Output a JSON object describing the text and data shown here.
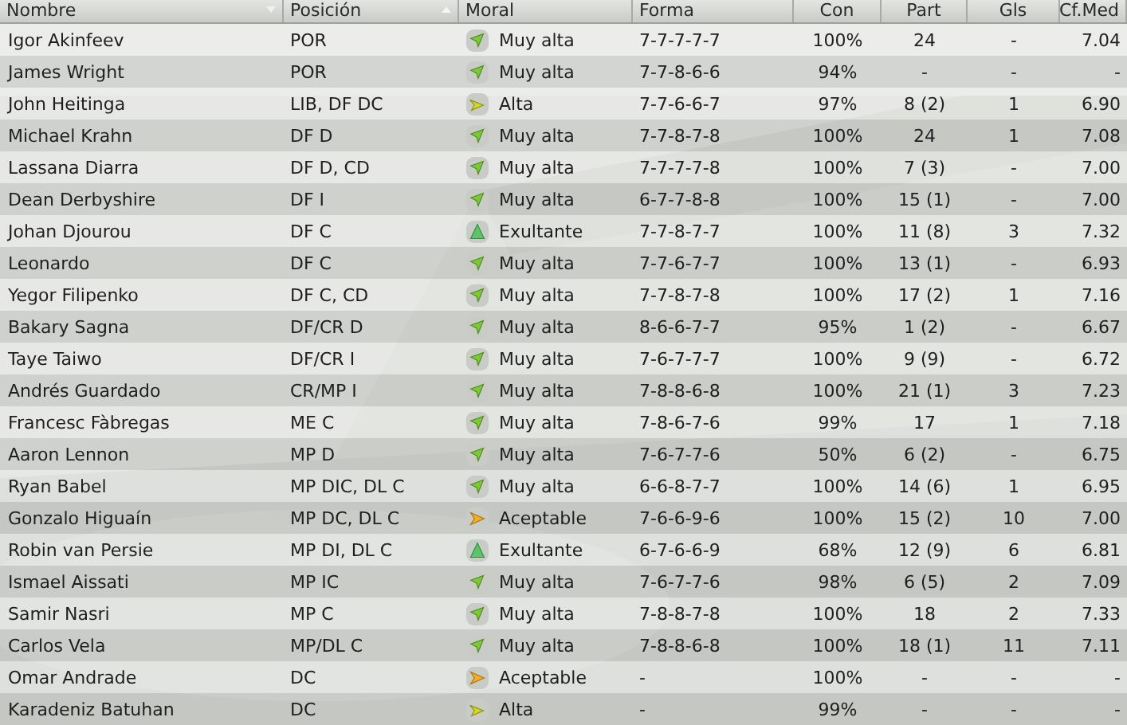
{
  "columns": [
    {
      "label": "Nombre",
      "sort_ascending": false,
      "sort_descending": true
    },
    {
      "label": "Posición",
      "sort_ascending": true,
      "sort_descending": false
    },
    {
      "label": "Moral",
      "sort_ascending": false,
      "sort_descending": false
    },
    {
      "label": "Forma",
      "sort_ascending": false,
      "sort_descending": false
    },
    {
      "label": "Con",
      "sort_ascending": false,
      "sort_descending": false
    },
    {
      "label": "Part",
      "sort_ascending": false,
      "sort_descending": false
    },
    {
      "label": "Gls",
      "sort_ascending": false,
      "sort_descending": false
    },
    {
      "label": "Cf.Med",
      "sort_ascending": false,
      "sort_descending": false
    }
  ],
  "rows": [
    {
      "name": "Igor Akinfeev",
      "position": "POR",
      "kind": "very_high",
      "morale": "Muy alta",
      "form": "7-7-7-7-7",
      "con": "100%",
      "part": "24",
      "gls": "-",
      "avg": "7.04"
    },
    {
      "name": "James Wright",
      "position": "POR",
      "kind": "very_high",
      "morale": "Muy alta",
      "form": "7-7-8-6-6",
      "con": "94%",
      "part": "-",
      "gls": "-",
      "avg": "-"
    },
    {
      "name": "John Heitinga",
      "position": "LIB, DF DC",
      "kind": "high",
      "morale": "Alta",
      "form": "7-7-6-6-7",
      "con": "97%",
      "part": "8 (2)",
      "gls": "1",
      "avg": "6.90"
    },
    {
      "name": "Michael Krahn",
      "position": "DF D",
      "kind": "very_high",
      "morale": "Muy alta",
      "form": "7-7-8-7-8",
      "con": "100%",
      "part": "24",
      "gls": "1",
      "avg": "7.08"
    },
    {
      "name": "Lassana Diarra",
      "position": "DF D, CD",
      "kind": "very_high",
      "morale": "Muy alta",
      "form": "7-7-7-7-8",
      "con": "100%",
      "part": "7 (3)",
      "gls": "-",
      "avg": "7.00"
    },
    {
      "name": "Dean Derbyshire",
      "position": "DF I",
      "kind": "very_high",
      "morale": "Muy alta",
      "form": "6-7-7-8-8",
      "con": "100%",
      "part": "15 (1)",
      "gls": "-",
      "avg": "7.00"
    },
    {
      "name": "Johan Djourou",
      "position": "DF C",
      "kind": "superb",
      "morale": "Exultante",
      "form": "7-7-8-7-7",
      "con": "100%",
      "part": "11 (8)",
      "gls": "3",
      "avg": "7.32"
    },
    {
      "name": "Leonardo",
      "position": "DF C",
      "kind": "very_high",
      "morale": "Muy alta",
      "form": "7-7-6-7-7",
      "con": "100%",
      "part": "13 (1)",
      "gls": "-",
      "avg": "6.93"
    },
    {
      "name": "Yegor Filipenko",
      "position": "DF C, CD",
      "kind": "very_high",
      "morale": "Muy alta",
      "form": "7-7-8-7-8",
      "con": "100%",
      "part": "17 (2)",
      "gls": "1",
      "avg": "7.16"
    },
    {
      "name": "Bakary Sagna",
      "position": "DF/CR D",
      "kind": "very_high",
      "morale": "Muy alta",
      "form": "8-6-6-7-7",
      "con": "95%",
      "part": "1 (2)",
      "gls": "-",
      "avg": "6.67"
    },
    {
      "name": "Taye Taiwo",
      "position": "DF/CR I",
      "kind": "very_high",
      "morale": "Muy alta",
      "form": "7-6-7-7-7",
      "con": "100%",
      "part": "9 (9)",
      "gls": "-",
      "avg": "6.72"
    },
    {
      "name": "Andrés Guardado",
      "position": "CR/MP I",
      "kind": "very_high",
      "morale": "Muy alta",
      "form": "7-8-8-6-8",
      "con": "100%",
      "part": "21 (1)",
      "gls": "3",
      "avg": "7.23"
    },
    {
      "name": "Francesc Fàbregas",
      "position": "ME C",
      "kind": "very_high",
      "morale": "Muy alta",
      "form": "7-8-6-7-6",
      "con": "99%",
      "part": "17",
      "gls": "1",
      "avg": "7.18"
    },
    {
      "name": "Aaron Lennon",
      "position": "MP D",
      "kind": "very_high",
      "morale": "Muy alta",
      "form": "7-6-7-7-6",
      "con": "50%",
      "part": "6 (2)",
      "gls": "-",
      "avg": "6.75"
    },
    {
      "name": "Ryan Babel",
      "position": "MP DIC, DL C",
      "kind": "very_high",
      "morale": "Muy alta",
      "form": "6-6-8-7-7",
      "con": "100%",
      "part": "14 (6)",
      "gls": "1",
      "avg": "6.95"
    },
    {
      "name": "Gonzalo Higuaín",
      "position": "MP DC, DL C",
      "kind": "acceptable",
      "morale": "Aceptable",
      "form": "7-6-6-9-6",
      "con": "100%",
      "part": "15 (2)",
      "gls": "10",
      "avg": "7.00"
    },
    {
      "name": "Robin van Persie",
      "position": "MP DI, DL C",
      "kind": "superb",
      "morale": "Exultante",
      "form": "6-7-6-6-9",
      "con": "68%",
      "part": "12 (9)",
      "gls": "6",
      "avg": "6.81"
    },
    {
      "name": "Ismael Aissati",
      "position": "MP IC",
      "kind": "very_high",
      "morale": "Muy alta",
      "form": "7-6-7-7-6",
      "con": "98%",
      "part": "6 (5)",
      "gls": "2",
      "avg": "7.09"
    },
    {
      "name": "Samir Nasri",
      "position": "MP C",
      "kind": "very_high",
      "morale": "Muy alta",
      "form": "7-8-8-7-8",
      "con": "100%",
      "part": "18",
      "gls": "2",
      "avg": "7.33"
    },
    {
      "name": "Carlos Vela",
      "position": "MP/DL C",
      "kind": "very_high",
      "morale": "Muy alta",
      "form": "7-8-8-6-8",
      "con": "100%",
      "part": "18 (1)",
      "gls": "11",
      "avg": "7.11"
    },
    {
      "name": "Omar Andrade",
      "position": "DC",
      "kind": "acceptable",
      "morale": "Aceptable",
      "form": "-",
      "con": "100%",
      "part": "-",
      "gls": "-",
      "avg": "-"
    },
    {
      "name": "Karadeniz Batuhan",
      "position": "DC",
      "kind": "high",
      "morale": "Alta",
      "form": "-",
      "con": "99%",
      "part": "-",
      "gls": "-",
      "avg": "-"
    }
  ]
}
